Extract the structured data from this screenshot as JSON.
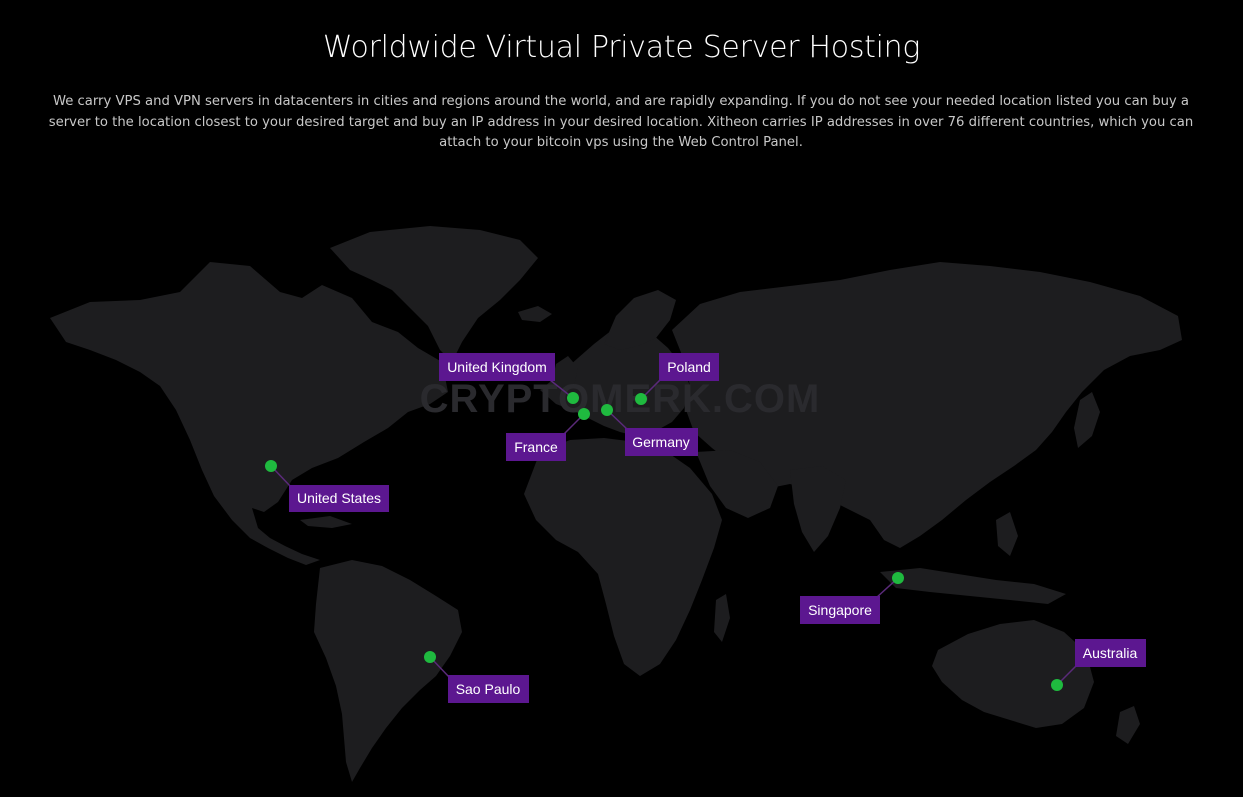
{
  "header": {
    "title": "Worldwide Virtual Private Server Hosting",
    "description": "We carry VPS and VPN servers in datacenters in cities and regions around the world, and are rapidly expanding. If you do not see your needed location listed you can buy a server to the location closest to your desired target and buy an IP address in your desired location. Xitheon carries IP addresses in over 76 different countries, which you can attach to your bitcoin vps using the Web Control Panel."
  },
  "map": {
    "watermark": "CRYPTOMERK.COM",
    "colors": {
      "background": "#000000",
      "land": "#1d1d1f",
      "marker": "#1fba3f",
      "label_background": "#5c1790",
      "label_text": "#ffffff"
    },
    "locations": [
      {
        "id": "united-states",
        "label": "United States"
      },
      {
        "id": "united-kingdom",
        "label": "United Kingdom"
      },
      {
        "id": "france",
        "label": "France"
      },
      {
        "id": "germany",
        "label": "Germany"
      },
      {
        "id": "poland",
        "label": "Poland"
      },
      {
        "id": "sao-paulo",
        "label": "Sao Paulo"
      },
      {
        "id": "singapore",
        "label": "Singapore"
      },
      {
        "id": "australia",
        "label": "Australia"
      }
    ]
  }
}
